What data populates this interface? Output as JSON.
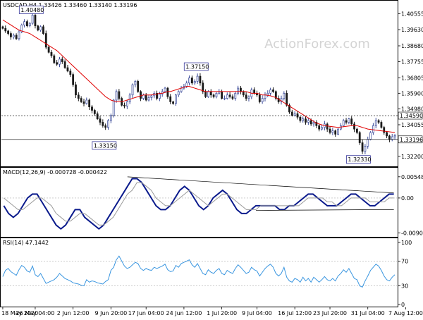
{
  "watermark": "ActionForex.com",
  "colors": {
    "bull": "#3b4b9a",
    "bear": "#1a1a1a",
    "candle_body_bull": "#ffffff",
    "ma": "#e00000",
    "macd": "#0a1a8c",
    "signal": "#9a9a9a",
    "rsi": "#3a96e0",
    "trendline": "#000000",
    "label_box": "#1a1a8c",
    "refline": "#000000"
  },
  "chart_data": [
    {
      "type": "candlestick",
      "title": "USDCAD,H4  1.33426 1.33460 1.33140 1.33196",
      "ylim": [
        1.317,
        1.412
      ],
      "y_ticks": [
        "1.40555",
        "1.39630",
        "1.38680",
        "1.37755",
        "1.36805",
        "1.35900",
        "1.34980",
        "1.34055",
        "1.33196",
        "1.32200"
      ],
      "y_tick_values": [
        1.40555,
        1.3963,
        1.3868,
        1.37755,
        1.36805,
        1.359,
        1.3498,
        1.34055,
        1.33196,
        1.322
      ],
      "x_ticks": [
        "18 May 2020",
        "26 May 04:00",
        "2 Jun 12:00",
        "9 Jun 20:00",
        "17 Jun 04:00",
        "24 Jun 12:00",
        "1 Jul 20:00",
        "9 Jul 04:00",
        "16 Jul 12:00",
        "23 Jul 20:00",
        "31 Jul 04:00",
        "7 Aug 12:00"
      ],
      "x_tick_index": [
        0,
        12,
        26,
        40,
        53,
        67,
        81,
        94,
        108,
        121,
        135,
        149
      ],
      "close": [
        1.397,
        1.3955,
        1.394,
        1.392,
        1.393,
        1.391,
        1.395,
        1.399,
        1.401,
        1.3985,
        1.4,
        1.4048,
        1.3985,
        1.396,
        1.398,
        1.394,
        1.386,
        1.383,
        1.381,
        1.377,
        1.376,
        1.379,
        1.3775,
        1.374,
        1.372,
        1.37,
        1.364,
        1.358,
        1.356,
        1.354,
        1.353,
        1.355,
        1.351,
        1.349,
        1.347,
        1.344,
        1.342,
        1.34,
        1.339,
        1.343,
        1.346,
        1.355,
        1.36,
        1.356,
        1.352,
        1.3515,
        1.354,
        1.358,
        1.364,
        1.366,
        1.36,
        1.356,
        1.358,
        1.355,
        1.3565,
        1.3575,
        1.359,
        1.356,
        1.3585,
        1.36,
        1.362,
        1.357,
        1.354,
        1.353,
        1.358,
        1.36,
        1.362,
        1.363,
        1.365,
        1.368,
        1.365,
        1.366,
        1.369,
        1.365,
        1.36,
        1.357,
        1.36,
        1.358,
        1.357,
        1.359,
        1.36,
        1.356,
        1.356,
        1.358,
        1.357,
        1.356,
        1.359,
        1.362,
        1.36,
        1.358,
        1.356,
        1.357,
        1.361,
        1.359,
        1.358,
        1.354,
        1.356,
        1.358,
        1.359,
        1.361,
        1.36,
        1.356,
        1.354,
        1.356,
        1.359,
        1.352,
        1.348,
        1.346,
        1.347,
        1.345,
        1.343,
        1.344,
        1.342,
        1.343,
        1.341,
        1.342,
        1.34,
        1.338,
        1.339,
        1.341,
        1.338,
        1.336,
        1.337,
        1.335,
        1.338,
        1.34,
        1.343,
        1.342,
        1.344,
        1.341,
        1.338,
        1.336,
        1.33,
        1.325,
        1.328,
        1.332,
        1.336,
        1.34,
        1.343,
        1.342,
        1.339,
        1.336,
        1.334,
        1.332,
        1.3335,
        1.3342
      ],
      "ma": [
        1.402,
        1.401,
        1.4,
        1.399,
        1.398,
        1.397,
        1.396,
        1.3955,
        1.395,
        1.3945,
        1.394,
        1.393,
        1.392,
        1.391,
        1.39,
        1.389,
        1.388,
        1.387,
        1.386,
        1.385,
        1.384,
        1.3825,
        1.381,
        1.3795,
        1.378,
        1.3765,
        1.375,
        1.3735,
        1.372,
        1.3705,
        1.369,
        1.3675,
        1.366,
        1.3645,
        1.363,
        1.3615,
        1.36,
        1.3585,
        1.357,
        1.356,
        1.355,
        1.3545,
        1.354,
        1.354,
        1.354,
        1.3545,
        1.355,
        1.3555,
        1.356,
        1.3565,
        1.357,
        1.3575,
        1.358,
        1.358,
        1.358,
        1.358,
        1.3585,
        1.3585,
        1.359,
        1.359,
        1.3595,
        1.36,
        1.36,
        1.3605,
        1.361,
        1.3615,
        1.362,
        1.3625,
        1.363,
        1.363,
        1.3625,
        1.362,
        1.3615,
        1.361,
        1.3605,
        1.36,
        1.36,
        1.36,
        1.36,
        1.36,
        1.36,
        1.36,
        1.36,
        1.36,
        1.36,
        1.36,
        1.36,
        1.36,
        1.36,
        1.36,
        1.36,
        1.3595,
        1.359,
        1.359,
        1.359,
        1.3585,
        1.358,
        1.358,
        1.3578,
        1.3575,
        1.357,
        1.3565,
        1.3555,
        1.3545,
        1.3535,
        1.3525,
        1.3515,
        1.3505,
        1.3495,
        1.3485,
        1.3475,
        1.3465,
        1.3455,
        1.3445,
        1.3435,
        1.3425,
        1.3415,
        1.341,
        1.3405,
        1.34,
        1.3398,
        1.3396,
        1.3394,
        1.3392,
        1.339,
        1.3392,
        1.3394,
        1.3396,
        1.3398,
        1.34,
        1.34,
        1.34,
        1.3395,
        1.339,
        1.3385,
        1.338,
        1.3378,
        1.3376,
        1.3374,
        1.3372,
        1.337,
        1.3368,
        1.3366,
        1.3364,
        1.3362,
        1.336
      ],
      "annotations": [
        {
          "text": "1.40480",
          "index": 10,
          "value": 1.4048
        },
        {
          "text": "1.37150",
          "index": 71,
          "value": 1.3715
        },
        {
          "text": "1.33150",
          "index": 37,
          "value": 1.3315
        },
        {
          "text": "1.32330",
          "index": 131,
          "value": 1.3233
        }
      ],
      "h_lines": [
        {
          "value": 1.3459,
          "label": "1.34590",
          "style": "dashed"
        },
        {
          "value": 1.33196,
          "label": "1.33196",
          "style": "solid"
        }
      ]
    },
    {
      "type": "line",
      "title": "MACD(12,26,9) -0.000728 -0.000422",
      "ylim": [
        -0.0095,
        0.006
      ],
      "y_ticks": [
        "0.005486",
        "0.00",
        "-0.009034"
      ],
      "y_tick_values": [
        0.005486,
        0.0,
        -0.009034
      ],
      "series": [
        {
          "name": "MACD",
          "values": [
            -0.002,
            -0.004,
            -0.005,
            -0.004,
            -0.002,
            0.0,
            0.001,
            0.001,
            -0.001,
            -0.003,
            -0.005,
            -0.007,
            -0.008,
            -0.007,
            -0.005,
            -0.003,
            -0.003,
            -0.005,
            -0.006,
            -0.007,
            -0.008,
            -0.007,
            -0.005,
            -0.003,
            -0.001,
            0.001,
            0.003,
            0.005,
            0.005,
            0.004,
            0.002,
            0.0,
            -0.002,
            -0.003,
            -0.003,
            -0.002,
            0.0,
            0.002,
            0.003,
            0.002,
            0.0,
            -0.002,
            -0.003,
            -0.002,
            0.0,
            0.001,
            0.002,
            0.001,
            -0.001,
            -0.003,
            -0.004,
            -0.004,
            -0.003,
            -0.002,
            -0.002,
            -0.002,
            -0.002,
            -0.002,
            -0.003,
            -0.003,
            -0.002,
            -0.002,
            -0.001,
            0.0,
            0.001,
            0.001,
            0.0,
            -0.001,
            -0.002,
            -0.002,
            -0.002,
            -0.001,
            0.0,
            0.001,
            0.001,
            0.0,
            -0.001,
            -0.002,
            -0.002,
            -0.001,
            0.0,
            0.001,
            0.001
          ]
        },
        {
          "name": "Signal",
          "values": [
            0.0,
            -0.001,
            -0.002,
            -0.003,
            -0.003,
            -0.002,
            -0.001,
            0.0,
            0.0,
            -0.001,
            -0.002,
            -0.004,
            -0.005,
            -0.006,
            -0.006,
            -0.005,
            -0.004,
            -0.004,
            -0.005,
            -0.006,
            -0.007,
            -0.007,
            -0.006,
            -0.005,
            -0.003,
            -0.001,
            0.001,
            0.002,
            0.004,
            0.004,
            0.003,
            0.002,
            0.0,
            -0.001,
            -0.002,
            -0.002,
            -0.001,
            0.0,
            0.001,
            0.002,
            0.001,
            0.0,
            -0.001,
            -0.002,
            -0.001,
            0.0,
            0.001,
            0.001,
            0.0,
            -0.001,
            -0.002,
            -0.003,
            -0.003,
            -0.003,
            -0.002,
            -0.002,
            -0.002,
            -0.002,
            -0.002,
            -0.002,
            -0.002,
            -0.002,
            -0.002,
            -0.001,
            0.0,
            0.0,
            0.0,
            0.0,
            -0.001,
            -0.001,
            -0.002,
            -0.002,
            -0.001,
            0.0,
            0.0,
            0.0,
            0.0,
            -0.001,
            -0.001,
            -0.001,
            -0.001,
            0.0,
            0.0
          ]
        }
      ],
      "trendlines": [
        {
          "from": [
            26,
            0.00548
          ],
          "to": [
            82,
            0.0013
          ]
        },
        {
          "from": [
            53,
            -0.0032
          ],
          "to": [
            82,
            -0.003
          ]
        }
      ]
    },
    {
      "type": "line",
      "title": "RSI(14) 47.1442",
      "ylim": [
        0,
        100
      ],
      "y_ticks": [
        "100",
        "70",
        "30",
        "0"
      ],
      "y_tick_values": [
        100,
        70,
        30,
        0
      ],
      "series": [
        {
          "name": "RSI",
          "values": [
            45,
            55,
            58,
            53,
            50,
            47,
            56,
            63,
            60,
            54,
            52,
            62,
            48,
            45,
            50,
            42,
            34,
            36,
            38,
            40,
            44,
            50,
            46,
            42,
            40,
            38,
            35,
            34,
            33,
            31,
            30,
            40,
            36,
            38,
            37,
            35,
            34,
            33,
            37,
            40,
            55,
            60,
            72,
            78,
            70,
            62,
            58,
            60,
            64,
            68,
            66,
            58,
            55,
            58,
            56,
            55,
            60,
            58,
            60,
            62,
            65,
            56,
            53,
            54,
            63,
            60,
            66,
            68,
            70,
            72,
            64,
            60,
            66,
            58,
            50,
            48,
            56,
            52,
            50,
            55,
            58,
            50,
            48,
            55,
            52,
            50,
            58,
            64,
            60,
            55,
            50,
            52,
            60,
            56,
            54,
            46,
            52,
            58,
            62,
            65,
            60,
            50,
            46,
            50,
            60,
            44,
            38,
            36,
            42,
            40,
            36,
            44,
            38,
            42,
            36,
            44,
            40,
            36,
            40,
            45,
            40,
            38,
            42,
            38,
            46,
            50,
            56,
            52,
            58,
            50,
            42,
            40,
            30,
            28,
            38,
            46,
            55,
            60,
            65,
            62,
            55,
            46,
            40,
            38,
            44,
            48
          ]
        }
      ]
    }
  ]
}
